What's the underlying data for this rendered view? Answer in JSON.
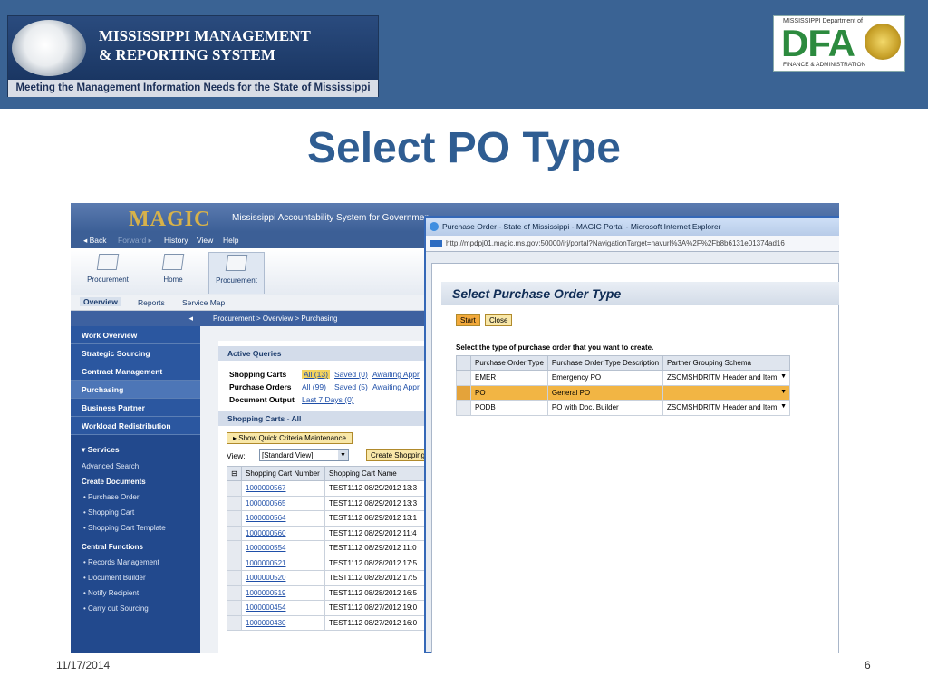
{
  "slide": {
    "title": "Select PO Type",
    "date": "11/17/2014",
    "page": "6"
  },
  "banner": {
    "line1": "MISSISSIPPI MANAGEMENT",
    "line2": "& REPORTING SYSTEM",
    "tagline": "Meeting the Management Information Needs for the State of Mississippi"
  },
  "dfa_logo": {
    "top": "MISSISSIPPI Department of",
    "letters": "DFA",
    "bottom": "FINANCE & ADMINISTRATION"
  },
  "portal": {
    "logo": "MAGIC",
    "system_title": "Mississippi Accountability System for Governmen",
    "nav": {
      "back": "◂ Back",
      "forward": "Forward ▸",
      "history": "History",
      "view": "View",
      "help": "Help"
    },
    "icon_tabs": [
      "Procurement",
      "Home",
      "Procurement"
    ],
    "subnav": [
      "Overview",
      "Reports",
      "Service Map"
    ],
    "breadcrumb": "Procurement  >  Overview  >  Purchasing",
    "left_nav": {
      "collapse": "◂",
      "items": [
        "Work Overview",
        "Strategic Sourcing",
        "Contract Management",
        "Purchasing",
        "Business Partner",
        "Workload Redistribution"
      ],
      "services_label": "▾   Services",
      "advanced_search": "Advanced Search",
      "create_documents": "Create Documents",
      "create_items": [
        "Purchase Order",
        "Shopping Cart",
        "Shopping Cart Template"
      ],
      "central_functions": "Central Functions",
      "central_items": [
        "Records Management",
        "Document Builder",
        "Notify Recipient",
        "Carry out Sourcing"
      ]
    },
    "active_queries": {
      "title": "Active Queries",
      "rows": [
        {
          "label": "Shopping Carts",
          "all": "All (13)",
          "saved": "Saved (0)",
          "awaiting": "Awaiting Appr"
        },
        {
          "label": "Purchase Orders",
          "all": "All (99)",
          "saved": "Saved (5)",
          "awaiting": "Awaiting Appr"
        },
        {
          "label": "Document Output",
          "all": "Last 7 Days (0)"
        }
      ]
    },
    "carts": {
      "title": "Shopping Carts - All",
      "quick_criteria": "▸ Show Quick Criteria Maintenance",
      "view_label": "View:",
      "view_value": "[Standard View]",
      "create_button": "Create Shopping",
      "columns": [
        "Shopping Cart Number",
        "Shopping Cart Name"
      ],
      "rows": [
        [
          "1000000567",
          "TEST1112 08/29/2012 13:3"
        ],
        [
          "1000000565",
          "TEST1112 08/29/2012 13:3"
        ],
        [
          "1000000564",
          "TEST1112 08/29/2012 13:1"
        ],
        [
          "1000000560",
          "TEST1112 08/29/2012 11:4"
        ],
        [
          "1000000554",
          "TEST1112 08/29/2012 11:0"
        ],
        [
          "1000000521",
          "TEST1112 08/28/2012 17:5"
        ],
        [
          "1000000520",
          "TEST1112 08/28/2012 17:5"
        ],
        [
          "1000000519",
          "TEST1112 08/28/2012 16:5"
        ],
        [
          "1000000454",
          "TEST1112 08/27/2012 19:0"
        ],
        [
          "1000000430",
          "TEST1112 08/27/2012 16:0"
        ]
      ]
    }
  },
  "popup": {
    "window_title": "Purchase Order - State of Mississippi - MAGIC Portal - Microsoft Internet Explorer",
    "url": "http://mpdpj01.magic.ms.gov:50000/irj/portal?NavigationTarget=navurl%3A%2F%2Fb8b6131e01374ad16",
    "heading": "Select Purchase Order Type",
    "start_button": "Start",
    "close_button": "Close",
    "instruction": "Select the type of purchase order that you want to create.",
    "columns": [
      "Purchase Order Type",
      "Purchase Order Type Description",
      "Partner Grouping Schema"
    ],
    "rows": [
      {
        "type": "EMER",
        "desc": "Emergency PO",
        "schema": "ZSOMSHDRITM Header and Item"
      },
      {
        "type": "PO",
        "desc": "General PO",
        "schema": ""
      },
      {
        "type": "PODB",
        "desc": "PO with Doc. Builder",
        "schema": "ZSOMSHDRITM Header and Item"
      }
    ]
  }
}
